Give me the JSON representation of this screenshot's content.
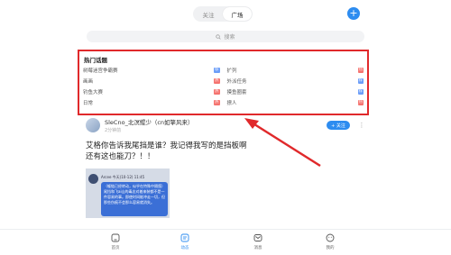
{
  "header": {
    "tabs": [
      {
        "label": "关注",
        "active": false
      },
      {
        "label": "广场",
        "active": true
      }
    ],
    "add_button_label": "+"
  },
  "search": {
    "placeholder": "搜索"
  },
  "hot_topics": {
    "title": "热门话题",
    "items": [
      {
        "label": "树莓迷宫争霸赛",
        "badge": "荐",
        "badge_color": "#6c9ef8"
      },
      {
        "label": "扩列",
        "badge": "热",
        "badge_color": "#f5736f"
      },
      {
        "label": "画画",
        "badge": "热",
        "badge_color": "#f5736f"
      },
      {
        "label": "外派任务",
        "badge": "荐",
        "badge_color": "#6c9ef8"
      },
      {
        "label": "钓鱼大赛",
        "badge": "热",
        "badge_color": "#f5736f"
      },
      {
        "label": "摸鱼圈套",
        "badge": "荐",
        "badge_color": "#6c9ef8"
      },
      {
        "label": "日常",
        "badge": "热",
        "badge_color": "#f5736f"
      },
      {
        "label": "撩人",
        "badge": "热",
        "badge_color": "#f5736f"
      }
    ]
  },
  "post": {
    "username": "SleCno_北溟鲲少（cn如擎风来）",
    "time": "2分钟前",
    "follow_label": "+ 关注",
    "more_label": "⋮",
    "content": "艾格你告诉我尾挡是谁？我记得我写的是挡板啊还有这也能刀？！！",
    "image": {
      "name_line": "Arcee  今天(10-12) 11:45",
      "bubble_text": "（躯链已经转动，似乎在特殊中隔蹙）尾挡和飞ai山的毒志对着来装都不是一件容易的事。即使时间能冲走一切，但那些伤痕不会那么容易就消失。"
    }
  },
  "bottom_nav": {
    "items": [
      {
        "label": "首页",
        "active": false
      },
      {
        "label": "动态",
        "active": true
      },
      {
        "label": "消息",
        "active": false
      },
      {
        "label": "我的",
        "active": false
      }
    ]
  },
  "colors": {
    "accent": "#2d8cf0",
    "highlight_border": "#e0292b",
    "hot_badge": "#f5736f",
    "recommend_badge": "#6c9ef8"
  }
}
